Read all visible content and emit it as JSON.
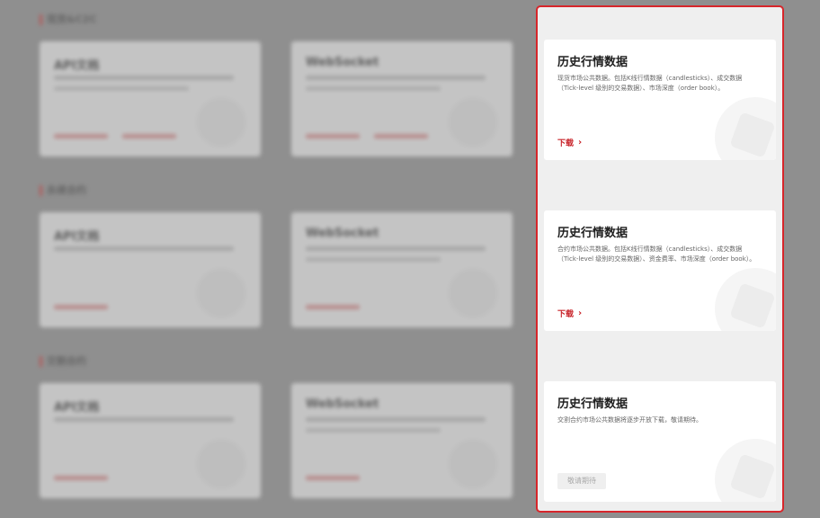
{
  "background": {
    "sections": [
      {
        "title": "现货&C2C",
        "cards": [
          {
            "title": "API文档"
          },
          {
            "title": "WebSocket"
          }
        ]
      },
      {
        "title": "永续合约",
        "cards": [
          {
            "title": "API文档"
          },
          {
            "title": "WebSocket"
          }
        ]
      },
      {
        "title": "交割合约",
        "cards": [
          {
            "title": "API文档"
          },
          {
            "title": "WebSocket"
          }
        ]
      }
    ]
  },
  "panel": {
    "cards": [
      {
        "title": "历史行情数据",
        "description": "现货市场公共数据。包括K线行情数据（candlesticks）、成交数据（Tick-level 级别的交易数据）、市场深度（order book）。",
        "action": "下载"
      },
      {
        "title": "历史行情数据",
        "description": "合约市场公共数据。包括K线行情数据（candlesticks）、成交数据（Tick-level 级别的交易数据）、资金费率、市场深度（order book）。",
        "action": "下载"
      },
      {
        "title": "历史行情数据",
        "description": "交割合约市场公共数据将逐步开放下载，敬请期待。",
        "action": "敬请期待"
      }
    ]
  },
  "colors": {
    "accent": "#d7262b",
    "link": "#c8242a"
  }
}
